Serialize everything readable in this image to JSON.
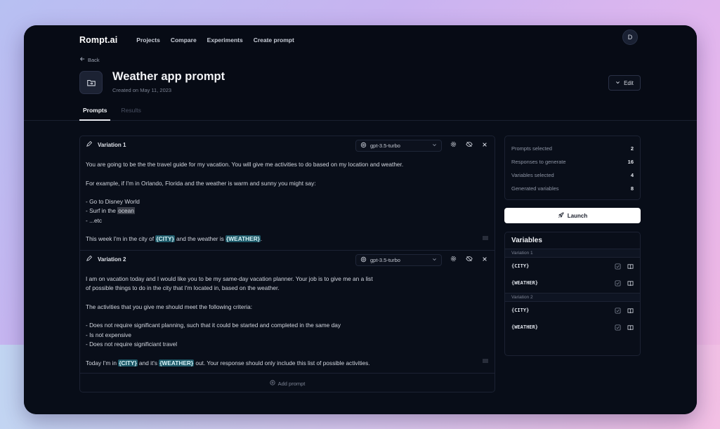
{
  "navbar": {
    "logo": "Rompt.ai",
    "links": [
      "Projects",
      "Compare",
      "Experiments",
      "Create prompt"
    ],
    "avatar_initial": "D"
  },
  "header": {
    "back_label": "Back",
    "title": "Weather app prompt",
    "created": "Created on May 11, 2023",
    "edit_label": "Edit"
  },
  "tabs": [
    {
      "label": "Prompts",
      "active": true
    },
    {
      "label": "Results",
      "active": false
    }
  ],
  "variations": [
    {
      "name": "Variation 1",
      "model": "gpt-3.5-turbo",
      "lines": {
        "l1": "You are going to be the the travel guide for my vacation. You will give me activities to do based on my location and weather.",
        "l2": "For example, if I'm in Orlando, Florida and the weather is warm and sunny you might say:",
        "l3": "- Go to Disney World",
        "l4a": "- Surf in the ",
        "l4b": "ocean",
        "l5": "- ...etc",
        "l6a": "This week I'm in the city of ",
        "l6b": "{CITY}",
        "l6c": " and the weather is ",
        "l6d": "{WEATHER}",
        "l6e": "."
      }
    },
    {
      "name": "Variation 2",
      "model": "gpt-3.5-turbo",
      "lines": {
        "l1": "I am on vacation today and I would like you to be my same-day vacation planner. Your job is to give me an a list",
        "l2": "of possible things to do in the city that I'm located in, based on the weather.",
        "l3": "The activities that you give me should meet the following criteria:",
        "l4": "- Does not require significant planning, such that it could be started and completed in the same day",
        "l5": "- Is not expensive",
        "l6": "- Does not require significiant travel",
        "l7a": "Today I'm in ",
        "l7b": "{CITY}",
        "l7c": " and it's ",
        "l7d": "{WEATHER}",
        "l7e": " out. Your response should only include this list of possible activities."
      }
    }
  ],
  "add_prompt_label": "Add prompt",
  "stats": [
    {
      "label": "Prompts selected",
      "value": "2"
    },
    {
      "label": "Responses to generate",
      "value": "16"
    },
    {
      "label": "Variables selected",
      "value": "4"
    },
    {
      "label": "Generated variables",
      "value": "8"
    }
  ],
  "launch_label": "Launch",
  "variables_panel": {
    "title": "Variables",
    "groups": [
      {
        "label": "Variation 1",
        "vars": [
          "{CITY}",
          "{WEATHER}"
        ]
      },
      {
        "label": "Variation 2",
        "vars": [
          "{CITY}",
          "{WEATHER}"
        ]
      }
    ]
  }
}
